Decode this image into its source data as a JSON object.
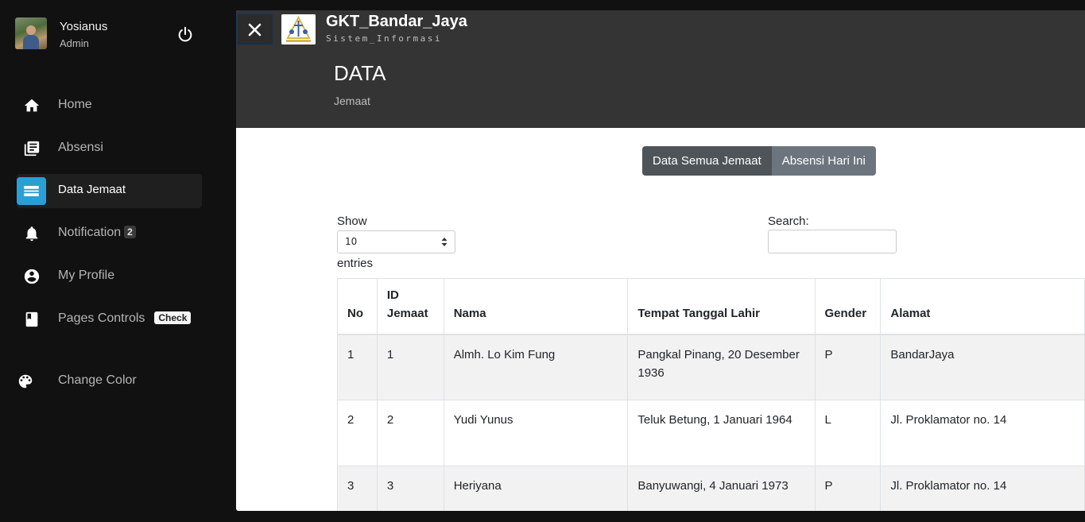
{
  "user": {
    "name": "Yosianus",
    "role": "Admin"
  },
  "nav": {
    "home": "Home",
    "absensi": "Absensi",
    "data_jemaat": "Data Jemaat",
    "notification": "Notification",
    "notification_count": "2",
    "my_profile": "My Profile",
    "pages_controls": "Pages Controls",
    "pages_controls_badge": "Check",
    "change_color": "Change Color"
  },
  "header": {
    "brand_title": "GKT_Bandar_Jaya",
    "brand_subtitle": "Sistem_Informasi",
    "page_title": "DATA",
    "page_subtitle": "Jemaat"
  },
  "tabs": {
    "all_members": "Data Semua Jemaat",
    "today_attendance": "Absensi Hari Ini"
  },
  "table_controls": {
    "show_label": "Show",
    "page_size": "10",
    "entries_label": "entries",
    "search_label": "Search:",
    "search_value": ""
  },
  "table": {
    "headers": [
      "No",
      "ID Jemaat",
      "Nama",
      "Tempat Tanggal Lahir",
      "Gender",
      "Alamat"
    ],
    "rows": [
      [
        "1",
        "1",
        "Almh. Lo Kim Fung",
        "Pangkal Pinang, 20 Desember 1936",
        "P",
        "BandarJaya"
      ],
      [
        "2",
        "2",
        "Yudi Yunus",
        "Teluk Betung, 1 Januari 1964",
        "L",
        "Jl. Proklamator no. 14"
      ],
      [
        "3",
        "3",
        "Heriyana",
        "Banyuwangi, 4 Januari 1973",
        "P",
        "Jl. Proklamator no. 14"
      ]
    ]
  },
  "colors": {
    "sidebar_bg": "#111111",
    "accent": "#2a9fd6",
    "header_bg": "#343434"
  },
  "icons": [
    "power-icon",
    "home-icon",
    "absensi-icon",
    "data-jemaat-icon",
    "bell-icon",
    "account-circle-icon",
    "book-icon",
    "palette-icon",
    "close-icon",
    "select-arrows-icon"
  ]
}
